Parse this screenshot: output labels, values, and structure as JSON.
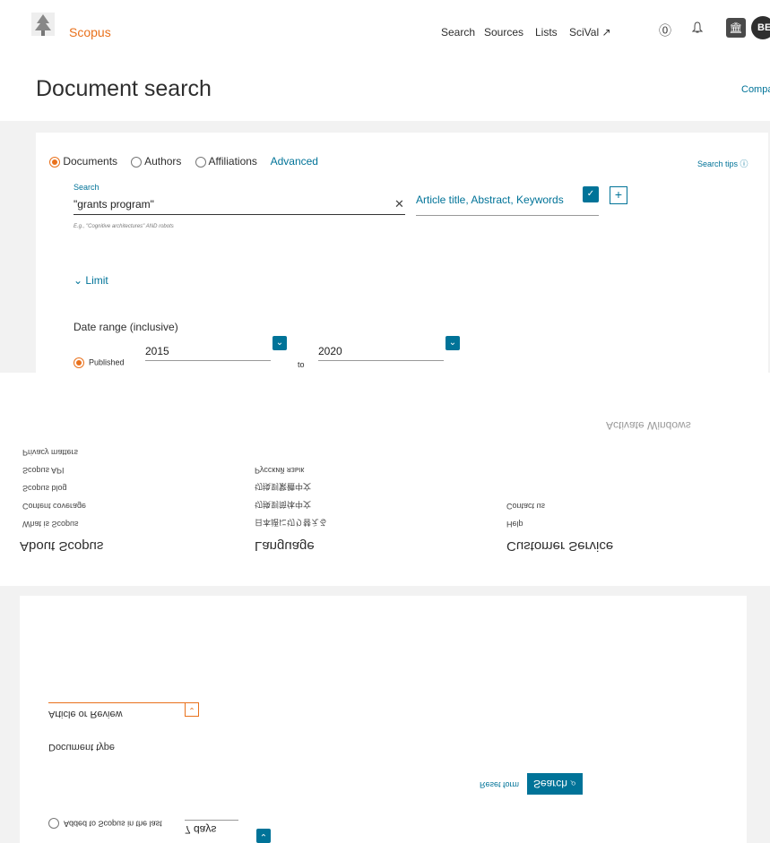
{
  "header": {
    "brand": "Scopus",
    "nav": [
      "Search",
      "Sources",
      "Lists",
      "SciVal ↗"
    ],
    "avatar": "BE"
  },
  "page": {
    "title": "Document search",
    "compare_link": "Compar"
  },
  "search": {
    "tabs": [
      "Documents",
      "Authors",
      "Affiliations",
      "Advanced"
    ],
    "search_tips": "Search tips ⓘ",
    "label": "Search",
    "value": "\"grants program\"",
    "example": "E.g., \"Cognitive architectures\" AND robots",
    "field": "Article title, Abstract, Keywords",
    "limit": "Limit",
    "date_range_label": "Date range (inclusive)",
    "published_label": "Published",
    "from_year": "2015",
    "to_label": "to",
    "to_year": "2020"
  },
  "footer": {
    "about": {
      "heading": "About Scopus",
      "links": [
        "What is Scopus",
        "Content coverage",
        "Scopus blog",
        "Scopus API",
        "Privacy matters"
      ]
    },
    "language": {
      "heading": "Language",
      "links": [
        "日本語に切り替える",
        "切换到简体中文",
        "切換到繁體中文",
        "Русский язык"
      ]
    },
    "service": {
      "heading": "Customer Service",
      "links": [
        "Help",
        "Contact us"
      ]
    },
    "watermark": "Activate Windows"
  },
  "lower_form": {
    "reset": "Reset form",
    "search_button": "Search",
    "document_type_label": "Document type",
    "document_type_value": "Article or Review",
    "added_label": "Added to Scopus in the last",
    "added_value": "7 days"
  },
  "colors": {
    "brand_orange": "#e9711c",
    "link_blue": "#007398"
  }
}
